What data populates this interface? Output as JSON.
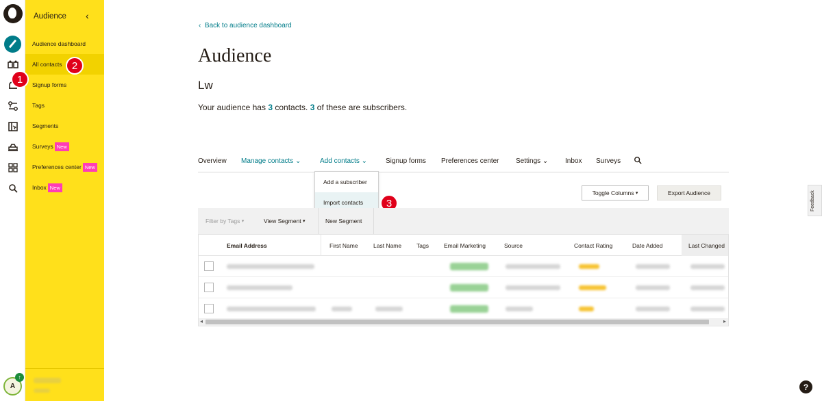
{
  "sidebar": {
    "header": "Audience",
    "items": [
      {
        "label": "Audience dashboard"
      },
      {
        "label": "All contacts"
      },
      {
        "label": "Signup forms"
      },
      {
        "label": "Tags"
      },
      {
        "label": "Segments"
      },
      {
        "label": "Surveys",
        "badge": "New"
      },
      {
        "label": "Preferences center",
        "badge": "New"
      },
      {
        "label": "Inbox",
        "badge": "New"
      }
    ],
    "avatar_initial": "A"
  },
  "markers": [
    "1",
    "2",
    "3"
  ],
  "main": {
    "back_link": "Back to audience dashboard",
    "title": "Audience",
    "audience_name": "Lw",
    "summary": {
      "prefix": "Your audience has",
      "contacts": "3",
      "middle": "contacts.",
      "subscribers": "3",
      "suffix": "of these are subscribers."
    },
    "tabs": [
      {
        "label": "Overview"
      },
      {
        "label": "Manage contacts",
        "caret": "⌄"
      },
      {
        "label": "Add contacts",
        "caret": "⌄"
      },
      {
        "label": "Signup forms"
      },
      {
        "label": "Preferences center"
      },
      {
        "label": "Settings",
        "caret": "⌄"
      },
      {
        "label": "Inbox"
      },
      {
        "label": "Surveys"
      }
    ],
    "add_contacts_menu": [
      "Add a subscriber",
      "Import contacts"
    ],
    "toggle_columns": "Toggle Columns",
    "export_audience": "Export Audience",
    "filter_bar": {
      "filter_tags": "Filter by Tags",
      "view_segment": "View Segment",
      "new_segment": "New Segment"
    },
    "table": {
      "columns": [
        "Email Address",
        "First Name",
        "Last Name",
        "Tags",
        "Email Marketing",
        "Source",
        "Contact Rating",
        "Date Added",
        "Last Changed"
      ]
    }
  },
  "feedback": "Feedback",
  "help": "?",
  "colors": {
    "sidebar_yellow": "#ffe01b",
    "accent_teal": "#007c89",
    "badge_pink": "#ff3db5",
    "marker_red": "#e0001a"
  }
}
